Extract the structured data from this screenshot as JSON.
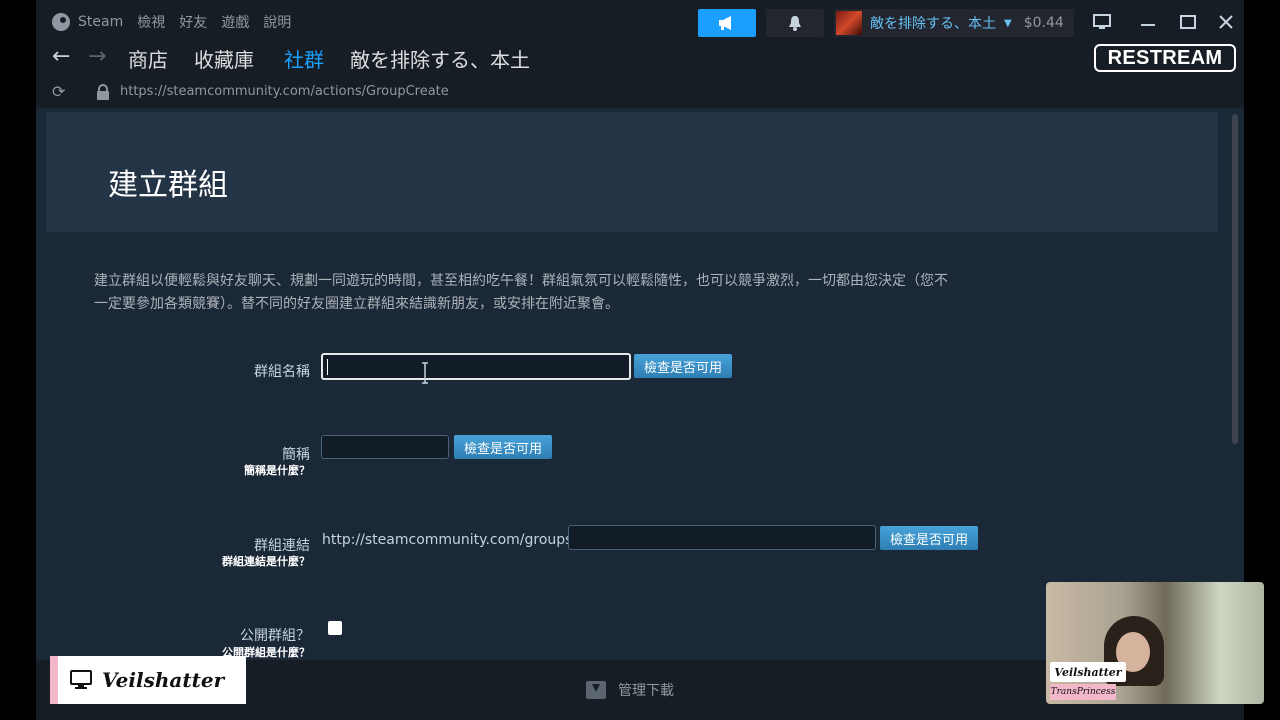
{
  "titlebar": {
    "menu": [
      "Steam",
      "檢視",
      "好友",
      "遊戲",
      "說明"
    ],
    "account_name": "敵を排除する、本土",
    "wallet": "$0.44"
  },
  "nav": {
    "tabs": [
      "商店",
      "收藏庫",
      "社群",
      "敵を排除する、本土"
    ],
    "active_tab": "社群"
  },
  "address_bar": {
    "url": "https://steamcommunity.com/actions/GroupCreate"
  },
  "page": {
    "title": "建立群組",
    "description": "建立群組以便輕鬆與好友聊天、規劃一同遊玩的時間，甚至相約吃午餐！群組氣氛可以輕鬆隨性，也可以競爭激烈，一切都由您決定（您不一定要參加各類競賽）。替不同的好友圈建立群組來結識新朋友，或安排在附近聚會。"
  },
  "form": {
    "group_name": {
      "label": "群組名稱",
      "value": "",
      "button": "檢查是否可用"
    },
    "abbreviation": {
      "label": "簡稱",
      "help": "簡稱是什麼？",
      "value": "",
      "button": "檢查是否可用"
    },
    "group_link": {
      "label": "群組連結",
      "help": "群組連結是什麼？",
      "prefix": "http://steamcommunity.com/groups/",
      "value": "",
      "button": "檢查是否可用"
    },
    "public_group": {
      "label": "公開群組？",
      "help": "公開群組是什麼？",
      "checked": false
    }
  },
  "footer": {
    "downloads": "管理下載"
  },
  "overlays": {
    "restream": "RESTREAM",
    "brand": "Veilshatter",
    "webcam_name": "Veilshatter",
    "webcam_tag": "TransPrincess"
  },
  "colors": {
    "accent": "#1a9fff",
    "link": "#66c0f4",
    "content_bg": "#1b2838",
    "header_band": "#243447"
  }
}
